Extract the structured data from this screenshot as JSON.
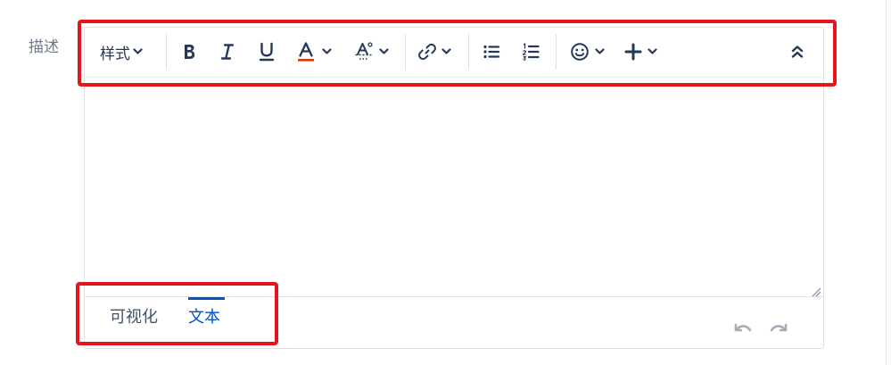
{
  "form": {
    "label": "描述"
  },
  "toolbar": {
    "style_label": "样式",
    "items": [
      {
        "name": "text-style",
        "icon": "chevron-down-icon"
      },
      {
        "name": "bold",
        "icon": "bold-icon"
      },
      {
        "name": "italic",
        "icon": "italic-icon"
      },
      {
        "name": "underline",
        "icon": "underline-icon"
      },
      {
        "name": "text-color",
        "icon": "text-color-icon"
      },
      {
        "name": "more-formatting",
        "icon": "strikethrough-icon"
      },
      {
        "name": "link",
        "icon": "link-icon"
      },
      {
        "name": "bullet-list",
        "icon": "bullet-list-icon"
      },
      {
        "name": "numbered-list",
        "icon": "numbered-list-icon"
      },
      {
        "name": "emoji",
        "icon": "emoji-icon"
      },
      {
        "name": "insert",
        "icon": "plus-icon"
      },
      {
        "name": "collapse-toolbar",
        "icon": "double-chevron-up-icon"
      }
    ]
  },
  "editor_modes": {
    "tabs": [
      "可视化",
      "文本"
    ],
    "active_tab": "文本"
  },
  "colors": {
    "text_dark": "#253858",
    "accent_blue": "#0052cc",
    "text_color_underline": "#de350b",
    "highlight_red": "#e8141c",
    "label_gray": "#6b778c",
    "disabled_gray": "#a5adba"
  }
}
